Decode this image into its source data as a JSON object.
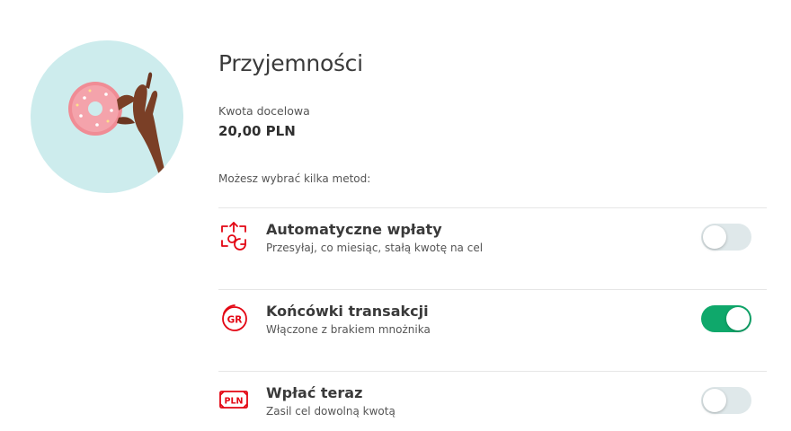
{
  "goal": {
    "image_icon": "donut-hand-image",
    "title": "Przyjemności",
    "target_label": "Kwota docelowa",
    "target_value": "20,00 PLN"
  },
  "methods_label": "Możesz wybrać kilka metod:",
  "methods": [
    {
      "icon": "auto-transfer-icon",
      "name": "Automatyczne wpłaty",
      "description": "Przesyłaj, co miesiąc, stałą kwotę na cel",
      "enabled": false
    },
    {
      "icon": "gr-coin-icon",
      "name": "Końcówki transakcji",
      "description": "Włączone z brakiem mnożnika",
      "enabled": true
    },
    {
      "icon": "pln-banknote-icon",
      "name": "Wpłać teraz",
      "description": "Zasil cel dowolną kwotą",
      "enabled": false
    }
  ],
  "colors": {
    "accent_red": "#e30613",
    "toggle_on": "#0fa86b",
    "toggle_off": "#dfe8ea",
    "image_background": "#cdeced"
  }
}
